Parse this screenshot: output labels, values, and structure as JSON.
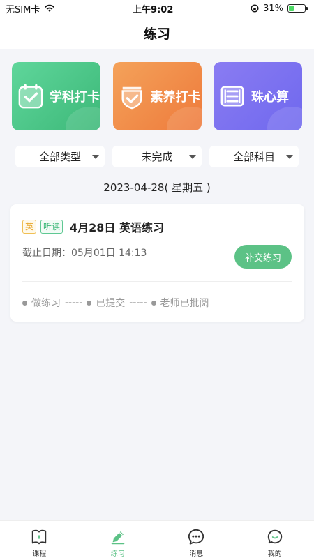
{
  "status_bar": {
    "carrier": "无SIM卡",
    "time": "上午9:02",
    "battery": "31%",
    "battery_level": 0.31
  },
  "header": {
    "title": "练习"
  },
  "feature_cards": [
    {
      "label": "学科打卡",
      "icon": "calendar-check-icon",
      "color": "#3cb878"
    },
    {
      "label": "素养打卡",
      "icon": "shield-check-icon",
      "color": "#ee7a3b"
    },
    {
      "label": "珠心算",
      "icon": "abacus-icon",
      "color": "#6f68ee"
    }
  ],
  "filters": [
    {
      "label": "全部类型"
    },
    {
      "label": "未完成"
    },
    {
      "label": "全部科目"
    }
  ],
  "date_title": "2023-04-28( 星期五 )",
  "task": {
    "subject_tag": "英",
    "type_tag": "听读",
    "title": "4月28日 英语练习",
    "deadline": "截止日期：05月01日 14:13",
    "action_label": "补交练习",
    "steps": [
      "做练习",
      "已提交",
      "老师已批阅"
    ],
    "separator": "-----"
  },
  "tabbar": [
    {
      "label": "课程",
      "icon": "book-icon",
      "active": false
    },
    {
      "label": "练习",
      "icon": "pencil-icon",
      "active": true
    },
    {
      "label": "消息",
      "icon": "chat-icon",
      "active": false
    },
    {
      "label": "我的",
      "icon": "face-icon",
      "active": false
    }
  ]
}
